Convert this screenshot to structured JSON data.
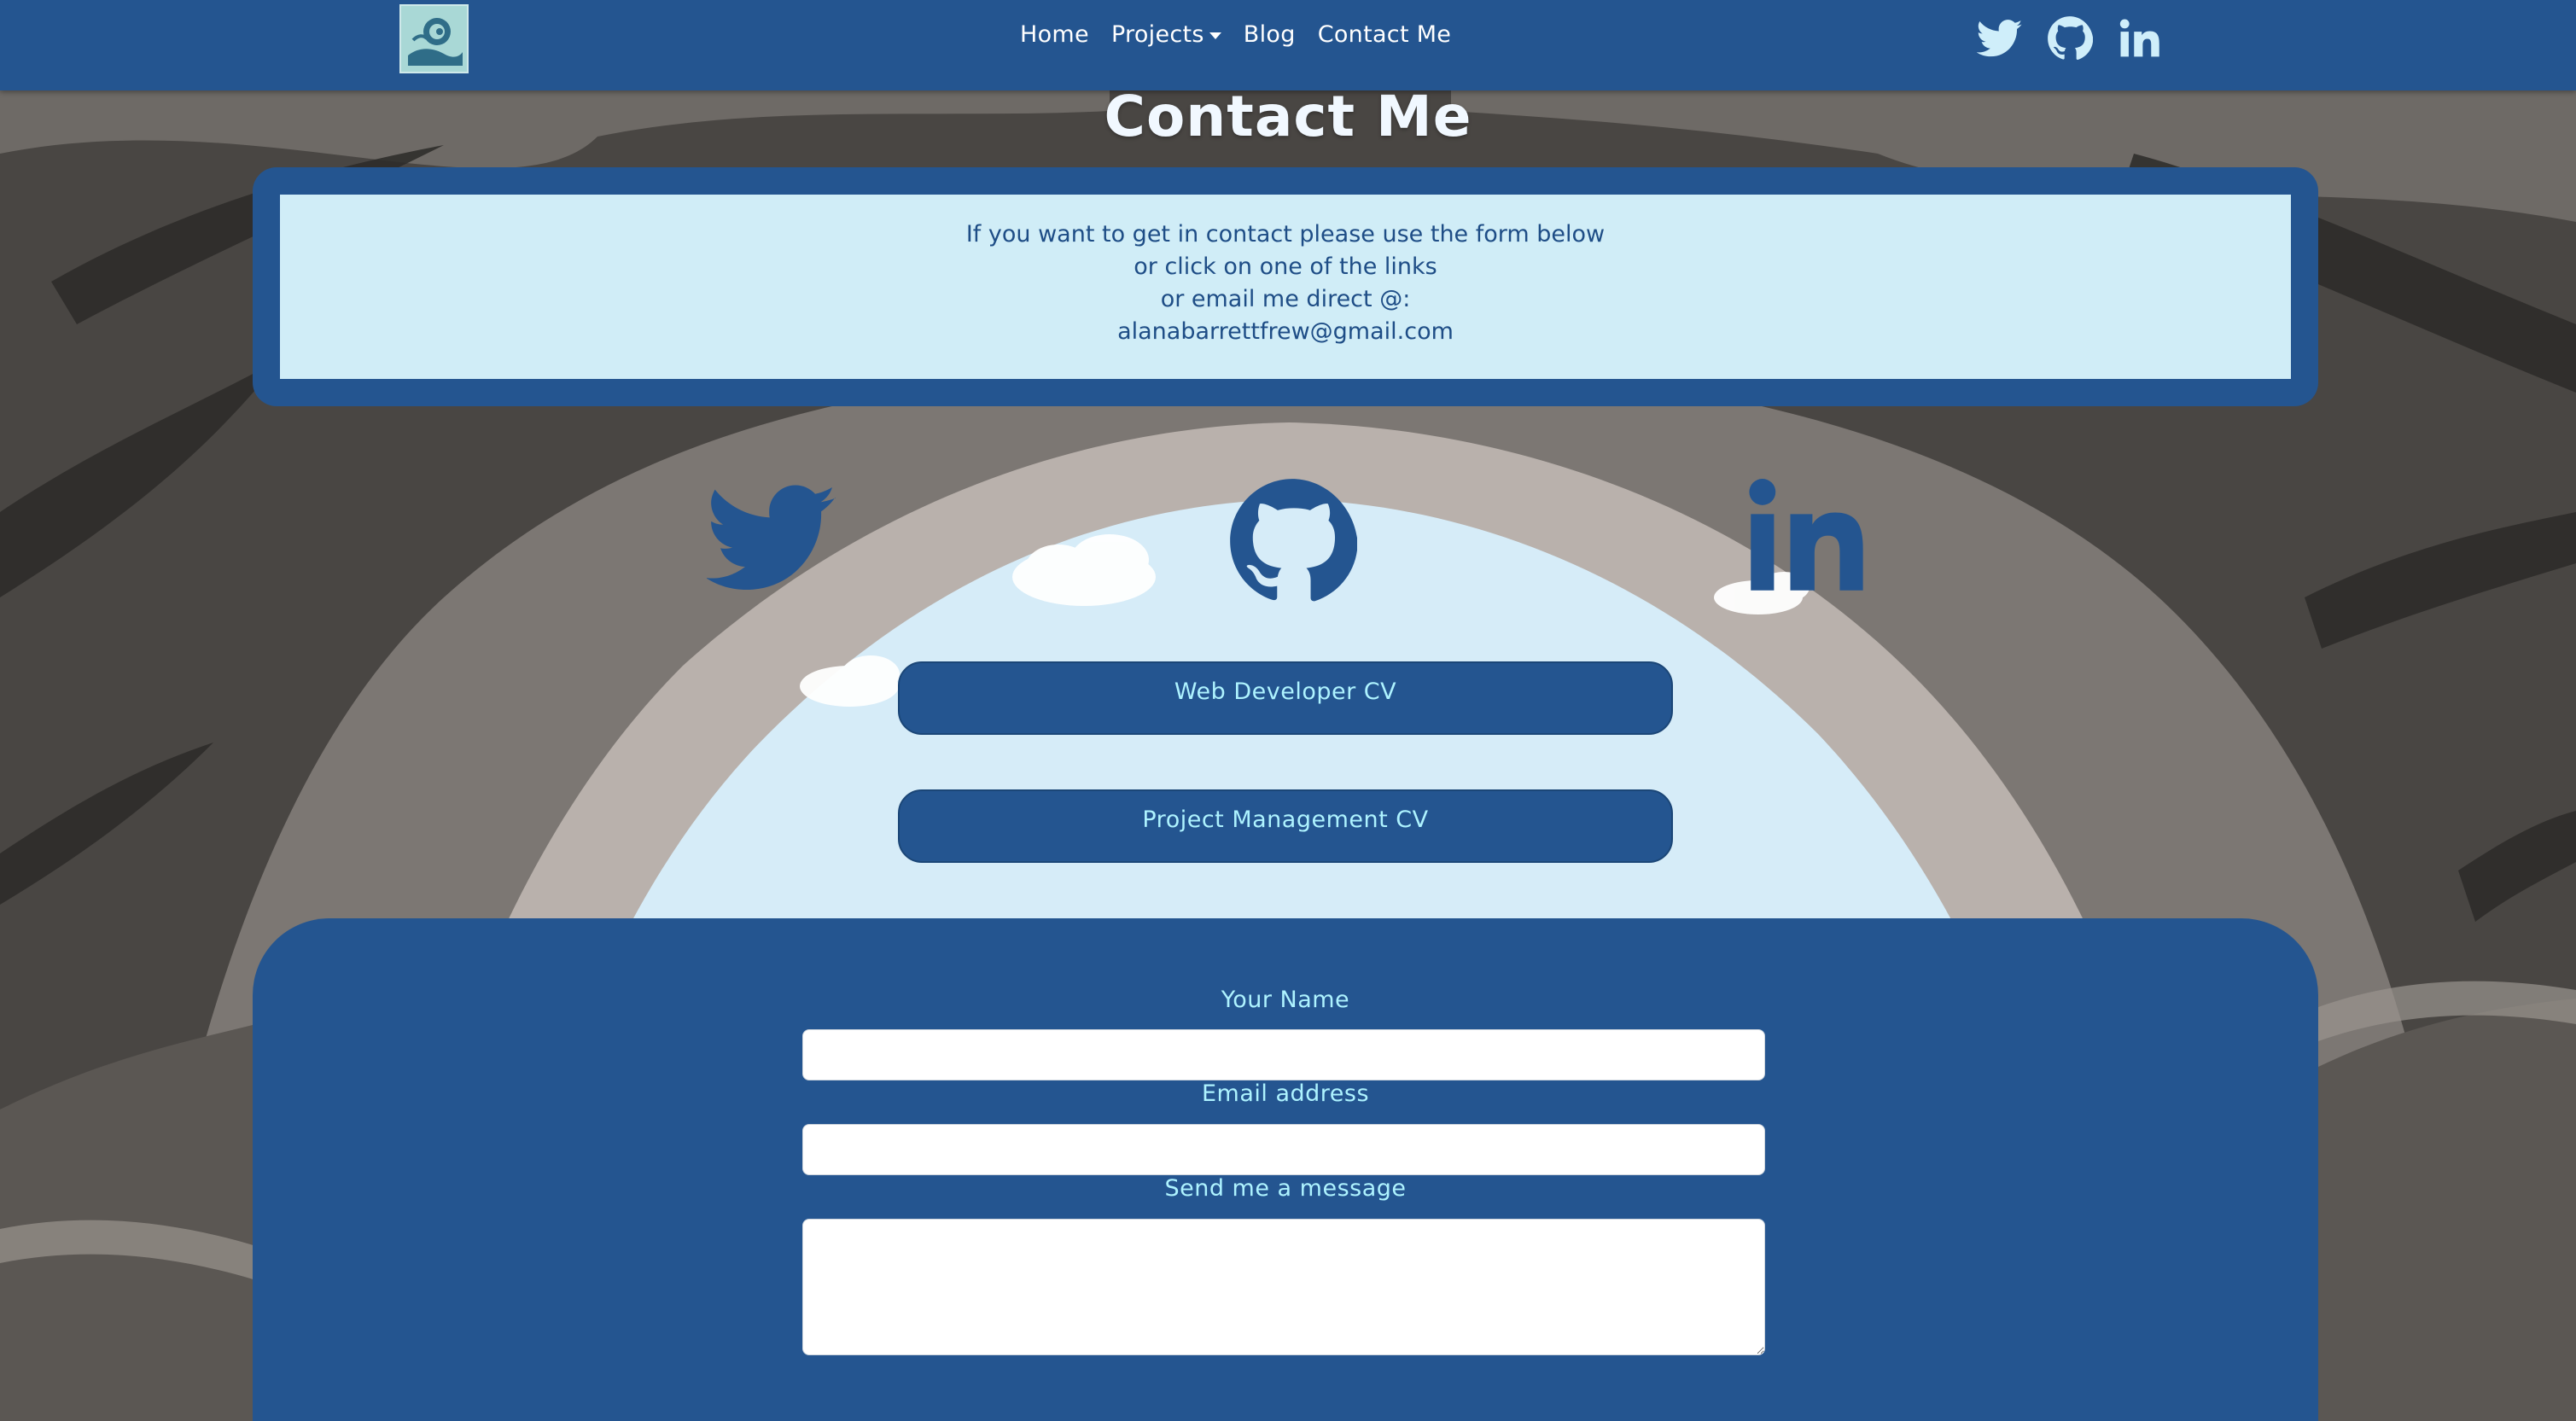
{
  "colors": {
    "primary": "#245590",
    "accent_text": "#aef3ff",
    "intro_bg": "#d0edf7",
    "intro_text": "#1e4d86",
    "sky": "#d6ecf8",
    "title": "#f1f8ff"
  },
  "navbar": {
    "logo_icon": "swirl-logo-icon",
    "links": [
      {
        "label": "Home"
      },
      {
        "label": "Projects",
        "has_dropdown": true
      },
      {
        "label": "Blog"
      },
      {
        "label": "Contact Me"
      }
    ],
    "icons": [
      "twitter-icon",
      "github-icon",
      "linkedin-icon"
    ]
  },
  "page": {
    "title": "Contact Me"
  },
  "intro": {
    "lines": [
      "If you want to get in contact please use the form below",
      "or click on one of the links",
      "or email me direct @:",
      "alanabarrettfrew@gmail.com"
    ]
  },
  "social_links": [
    "twitter-icon",
    "github-icon",
    "linkedin-icon"
  ],
  "cv_buttons": [
    {
      "label": "Web Developer CV"
    },
    {
      "label": "Project Management CV"
    }
  ],
  "form": {
    "name_label": "Your Name",
    "name_value": "",
    "email_label": "Email address",
    "email_value": "",
    "message_label": "Send me a message",
    "message_value": ""
  }
}
